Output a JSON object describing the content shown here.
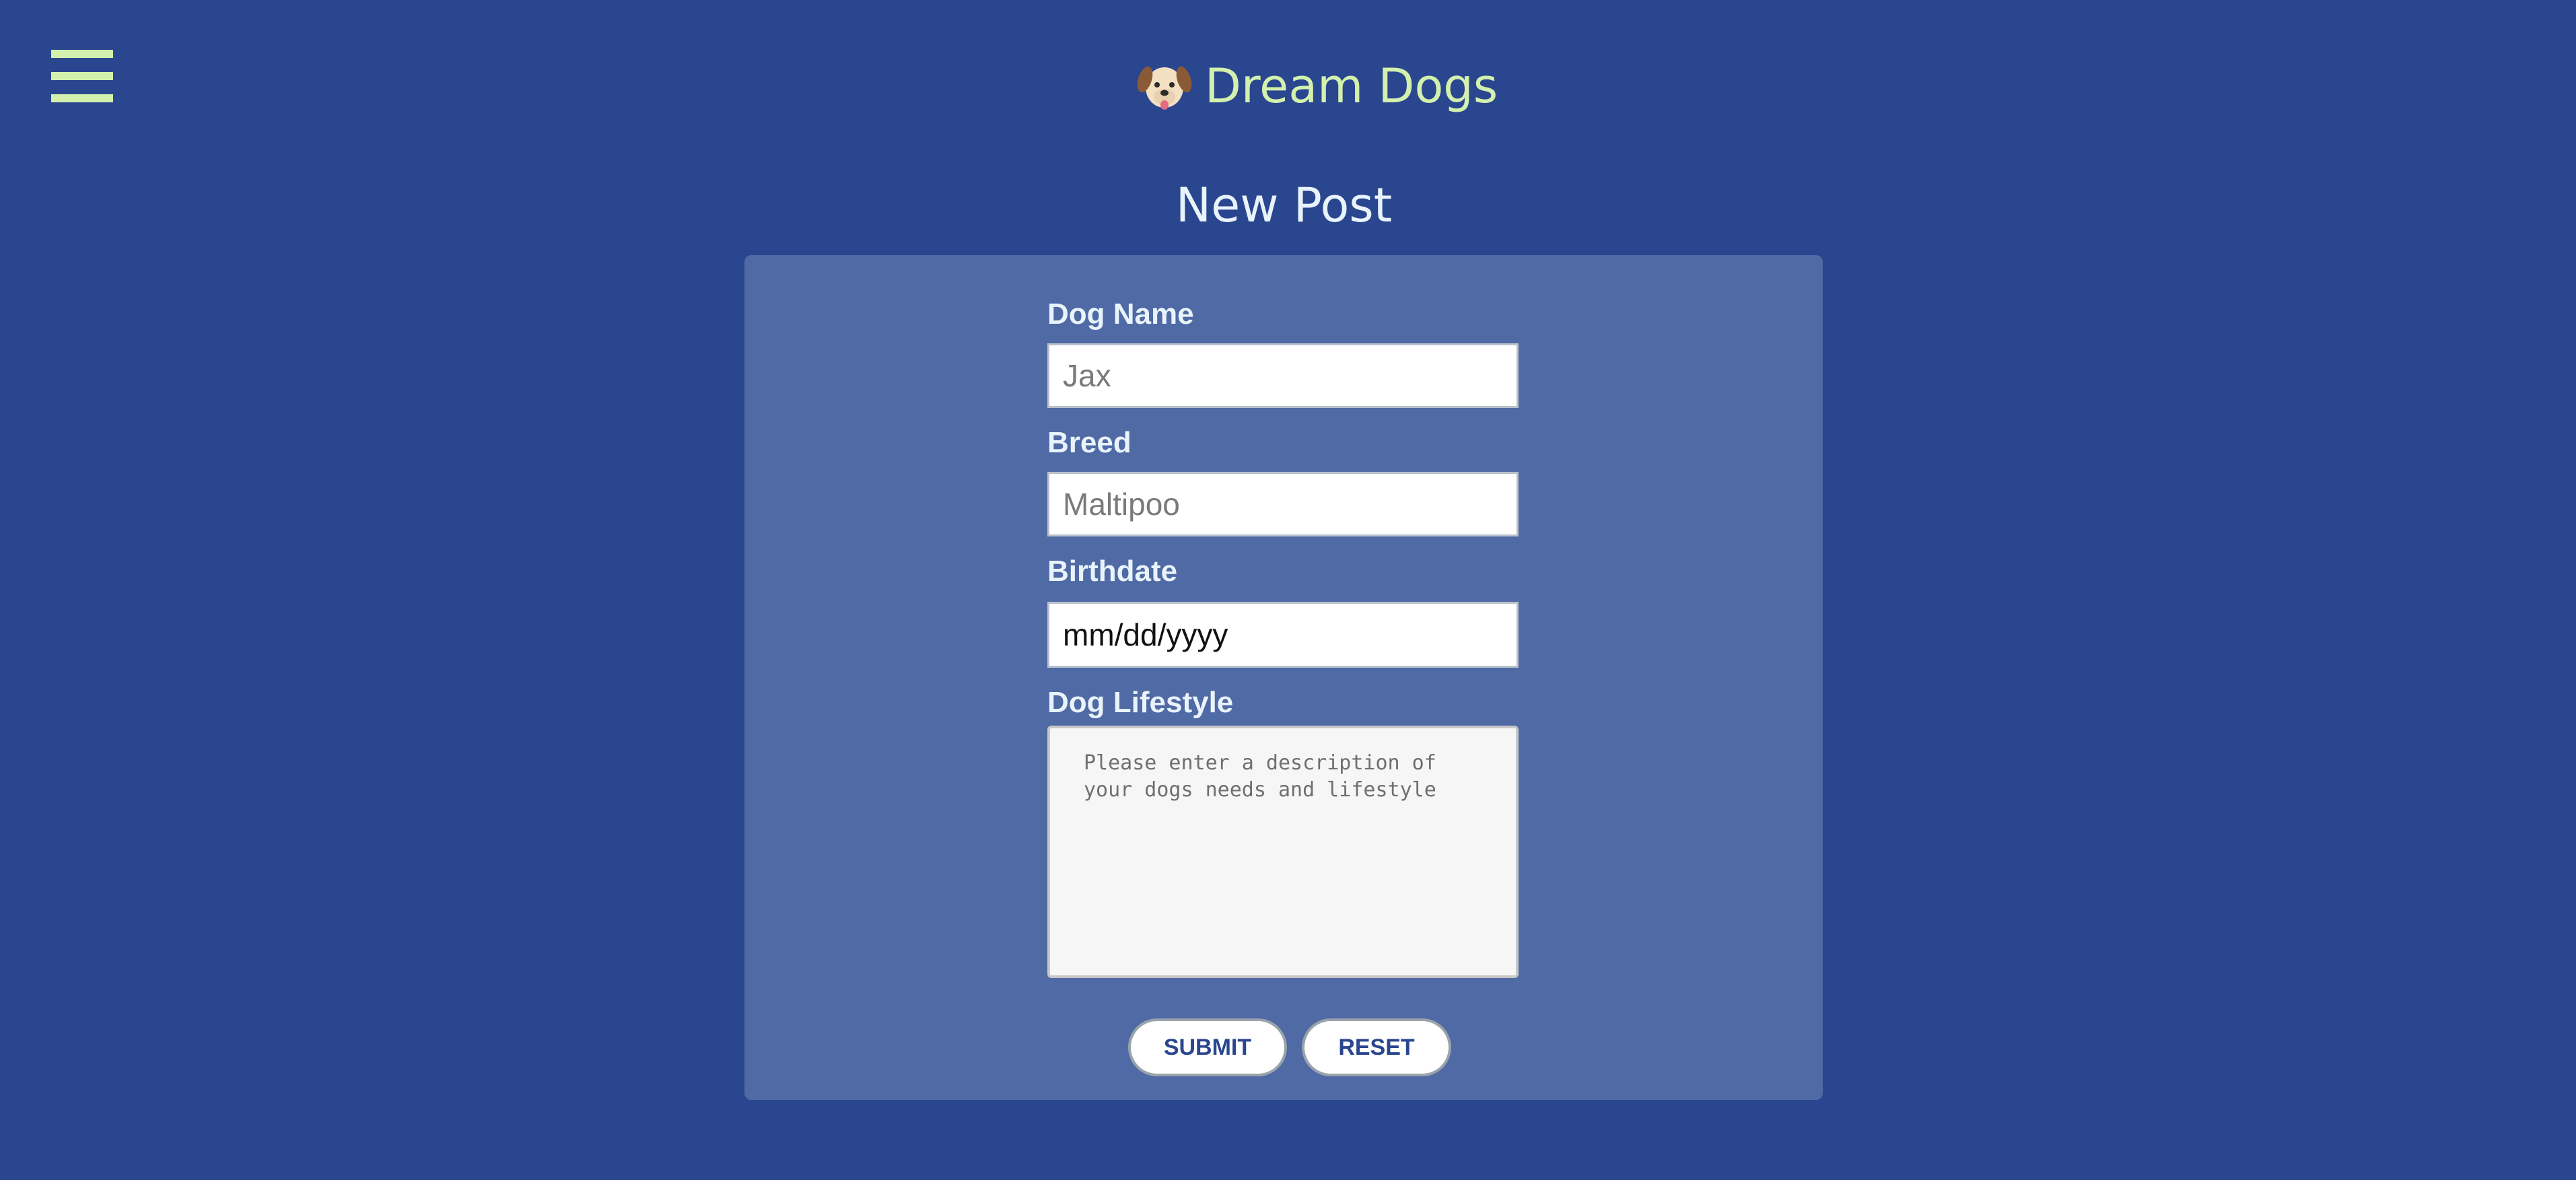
{
  "header": {
    "menu_icon": "hamburger-menu-icon",
    "brand_icon": "dog-face-icon",
    "brand_name": "Dream Dogs"
  },
  "page": {
    "title": "New Post"
  },
  "form": {
    "dog_name_label": "Dog Name",
    "dog_name_placeholder": "Jax",
    "breed_label": "Breed",
    "breed_placeholder": "Maltipoo",
    "birthdate_label": "Birthdate",
    "birthdate_value": "mm/dd/yyyy",
    "lifestyle_label": "Dog Lifestyle",
    "lifestyle_placeholder": "Please enter a description of your dogs needs and lifestyle",
    "submit_label": "SUBMIT",
    "reset_label": "RESET"
  },
  "colors": {
    "background": "#2a468f",
    "panel": "#4f6aa4",
    "accent": "#d3f1ad",
    "text_light": "#e9f3fb",
    "button_text": "#2a468f"
  }
}
